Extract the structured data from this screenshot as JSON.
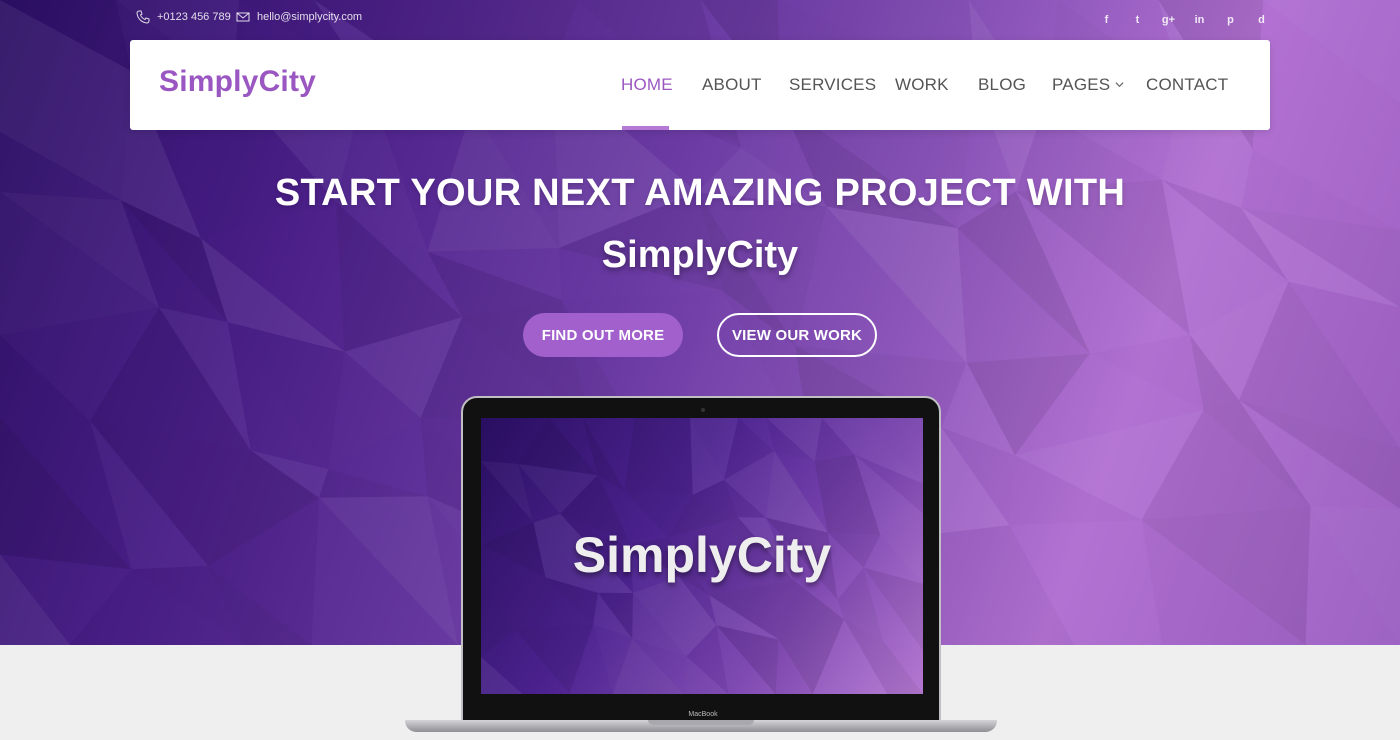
{
  "topbar": {
    "phone": "+0123 456 789",
    "email": "hello@simplycity.com",
    "social_icons": [
      "facebook-icon",
      "twitter-icon",
      "google-plus-icon",
      "linkedin-icon",
      "pinterest-icon",
      "dribbble-icon"
    ],
    "social_glyphs": [
      "f",
      "t",
      "g+",
      "in",
      "p",
      "d"
    ]
  },
  "navbar": {
    "logo": "SimplyCity",
    "items": [
      {
        "label": "HOME",
        "active": true
      },
      {
        "label": "ABOUT"
      },
      {
        "label": "SERVICES"
      },
      {
        "label": "WORK"
      },
      {
        "label": "BLOG"
      },
      {
        "label": "PAGES",
        "dropdown": true
      },
      {
        "label": "CONTACT"
      }
    ]
  },
  "hero": {
    "headline": "START YOUR NEXT AMAZING PROJECT WITH",
    "brand": "SimplyCity",
    "primary_button": "FIND OUT MORE",
    "secondary_button": "VIEW OUR WORK"
  },
  "laptop": {
    "screen_text": "SimplyCity",
    "model_label": "MacBook"
  },
  "colors": {
    "accent": "#9b57c1",
    "button": "#a160cc",
    "hero_dark": "#2b0f63",
    "hero_light": "#b271d2",
    "footer_bg": "#efefef"
  }
}
